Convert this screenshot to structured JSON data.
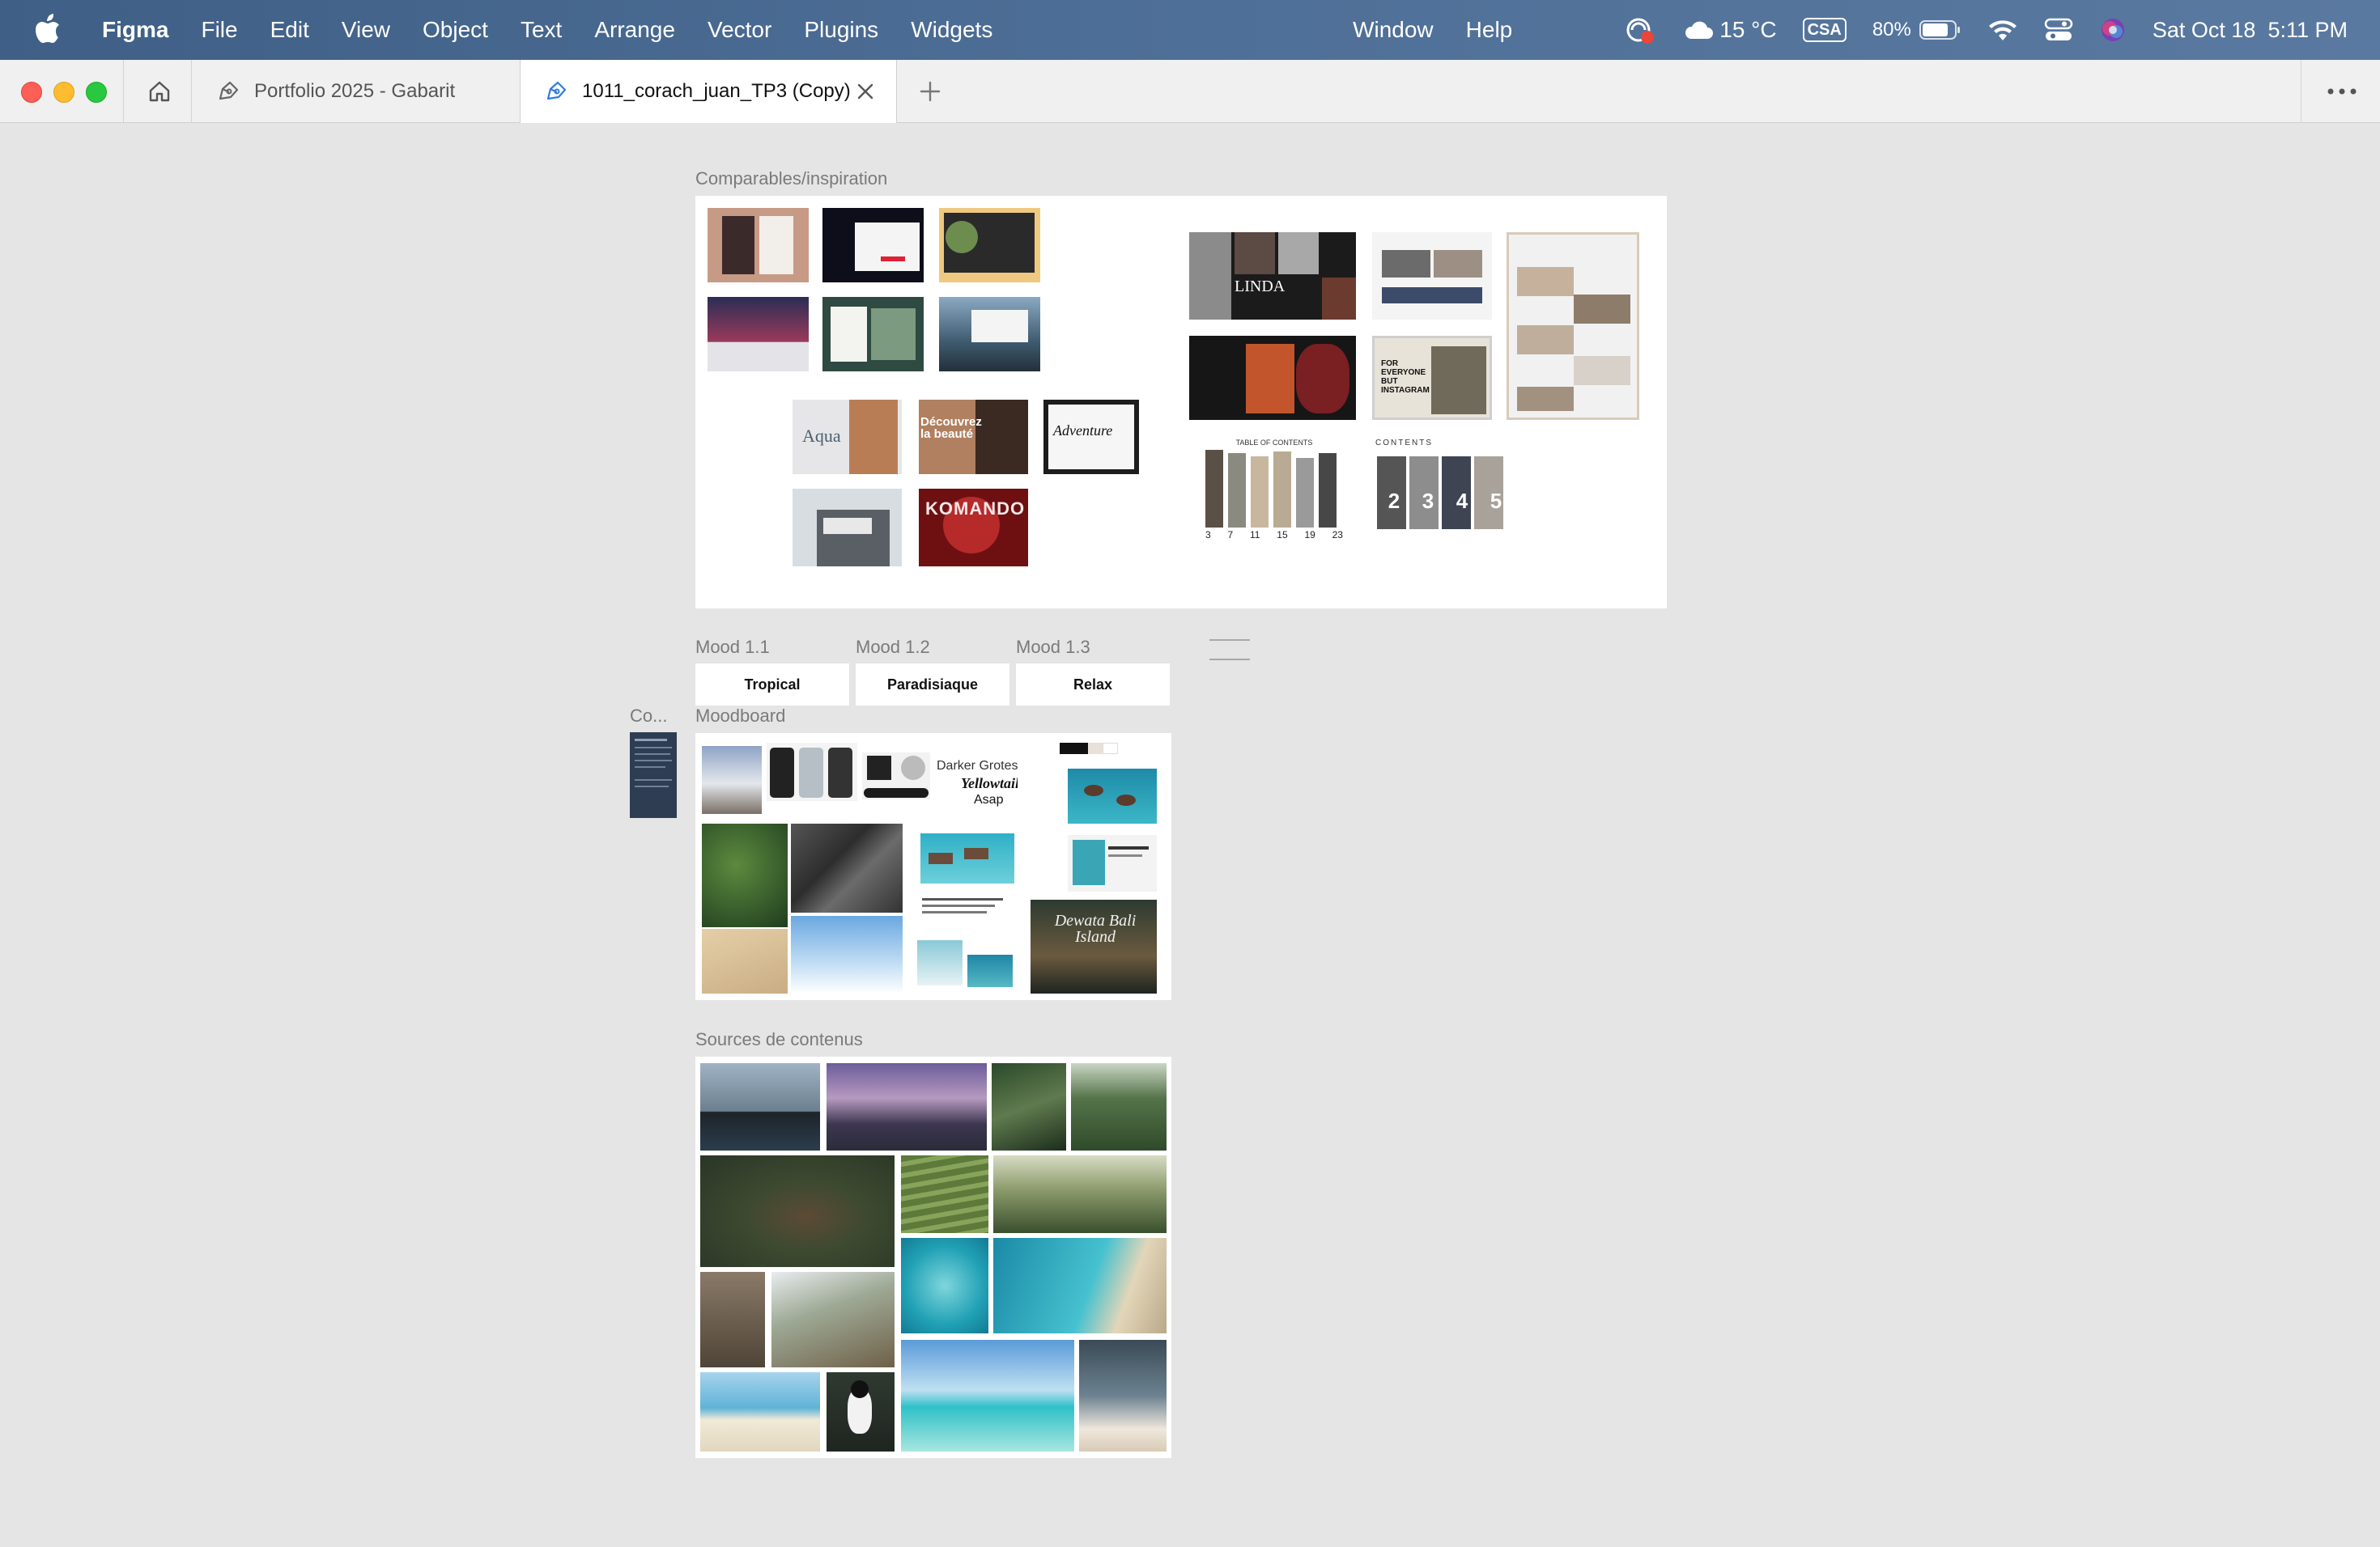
{
  "menubar": {
    "app": "Figma",
    "items": [
      "File",
      "Edit",
      "View",
      "Object",
      "Text",
      "Arrange",
      "Vector",
      "Plugins",
      "Widgets"
    ],
    "right_items": [
      "Window",
      "Help"
    ],
    "weather": "15 °C",
    "input_source": "CSA",
    "battery": "80%",
    "datetime": "Sat Oct 18  5:11 PM"
  },
  "tabs": {
    "inactive_label": "Portfolio 2025 - Gabarit",
    "active_label": "1011_corach_juan_TP3 (Copy)"
  },
  "canvas": {
    "comparables_label": "Comparables/inspiration",
    "moods": [
      {
        "label": "Mood 1.1",
        "title": "Tropical"
      },
      {
        "label": "Mood 1.2",
        "title": "Paradisiaque"
      },
      {
        "label": "Mood 1.3",
        "title": "Relax"
      }
    ],
    "co_label": "Co...",
    "moodboard_label": "Moodboard",
    "moodboard_fonts": [
      "Darker Grotesque",
      "Yellowtail",
      "Asap"
    ],
    "moodboard_bali": "Dewata Bali Island",
    "sources_label": "Sources de contenus",
    "thumb_texts": {
      "aqua": "Aqua",
      "beaute": "Découvrez la beauté",
      "adventure": "Adventure",
      "linda": "LINDA",
      "komando": "KOMANDO",
      "everyone": "FOR EVERYONE BUT INSTAGRAM",
      "toc": "TABLE OF CONTENTS",
      "contents": "CONTENTS",
      "toc_numbers": [
        "3",
        "7",
        "11",
        "15",
        "19",
        "23"
      ],
      "contents_numbers": [
        "2",
        "3",
        "4",
        "5"
      ]
    }
  },
  "colors": {
    "menubar": "#4a6b93",
    "canvas": "#e5e5e5",
    "tab_active": "#ffffff"
  }
}
